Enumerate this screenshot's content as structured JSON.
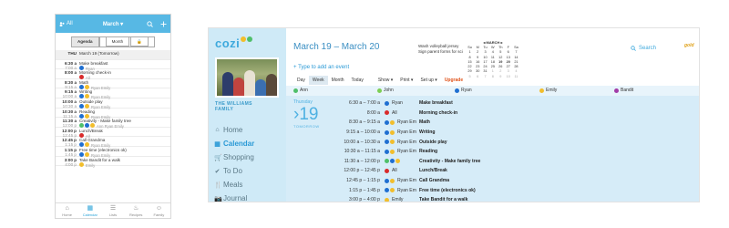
{
  "colors": {
    "ann": "#4fbf6a",
    "john": "#7ccf54",
    "ryan": "#1f6fd1",
    "emily": "#f2be2c",
    "bandit": "#a23ca8",
    "all": "#d92b2b",
    "brand": "#3ea9dd"
  },
  "mobile": {
    "top": {
      "all_label": "All",
      "month_label": "March"
    },
    "toggle": {
      "agenda": "Agenda",
      "month": "Month"
    },
    "date_header": {
      "day": "THU",
      "label": "March 19 (Tomorrow)"
    },
    "rows": [
      {
        "time": "6:30 a",
        "end": "7:00 a",
        "title": "Make breakfast",
        "who": "Ryan"
      },
      {
        "time": "8:00 a",
        "end": "",
        "title": "Morning check-in",
        "who": "All"
      },
      {
        "time": "8:30 a",
        "end": "9:15 a",
        "title": "Math",
        "who": "Ryan  Emily"
      },
      {
        "time": "9:15 a",
        "end": "10:00 a",
        "title": "Writing",
        "who": "Ryan  Emily"
      },
      {
        "time": "10:00 a",
        "end": "10:30 a",
        "title": "Outside play",
        "who": "Ryan  Emily"
      },
      {
        "time": "10:30 a",
        "end": "11:15 a",
        "title": "Reading",
        "who": "Ryan  Emily"
      },
      {
        "time": "11:30 a",
        "end": "12:00 p",
        "title": "Creativity - Make family tree",
        "who": "Ann  Ryan  Emily"
      },
      {
        "time": "12:00 p",
        "end": "12:45 p",
        "title": "Lunch/Break",
        "who": "All"
      },
      {
        "time": "12:45 p",
        "end": "1:15 p",
        "title": "Call Grandma",
        "who": "Ryan  Emily"
      },
      {
        "time": "1:15 p",
        "end": "1:45 p",
        "title": "Free time (electronics ok)",
        "who": "Ryan  Emily"
      },
      {
        "time": "3:00 p",
        "end": "4:00 p",
        "title": "Take Bandit for a walk",
        "who": "Emily"
      }
    ],
    "nav": [
      "Home",
      "Calendar",
      "Lists",
      "Recipes",
      "Family"
    ]
  },
  "desktop": {
    "logo": "cozi",
    "family_name_line1": "THE WILLIAMS",
    "family_name_line2": "FAMILY",
    "nav": [
      {
        "label": "Home",
        "icon": "house-icon"
      },
      {
        "label": "Calendar",
        "icon": "calendar-icon"
      },
      {
        "label": "Shopping",
        "icon": "cart-icon"
      },
      {
        "label": "To Do",
        "icon": "check-icon"
      },
      {
        "label": "Meals",
        "icon": "utensils-icon"
      },
      {
        "label": "Journal",
        "icon": "camera-icon"
      }
    ],
    "range": "March 19 – March 20",
    "notes": [
      "Wash volleyball jersey",
      "Sign parent forms for sci"
    ],
    "mini_cal": {
      "title": "MARCH",
      "headers": [
        "Su",
        "M",
        "Tu",
        "W",
        "Th",
        "F",
        "Sa"
      ],
      "weeks": [
        [
          "1",
          "2",
          "3",
          "4",
          "5",
          "6",
          "7"
        ],
        [
          "8",
          "9",
          "10",
          "11",
          "12",
          "13",
          "14"
        ],
        [
          "15",
          "16",
          "17",
          "18",
          "19",
          "20",
          "21"
        ],
        [
          "22",
          "23",
          "24",
          "25",
          "26",
          "27",
          "28"
        ],
        [
          "29",
          "30",
          "31",
          "1",
          "2",
          "3",
          "4"
        ],
        [
          "5",
          "6",
          "7",
          "8",
          "9",
          "10",
          "11"
        ]
      ]
    },
    "search_label": "Search",
    "gold_label": "gold",
    "type_add": "+ Type to add an event",
    "tabs": [
      "Day",
      "Week",
      "Month",
      "Today"
    ],
    "menus": [
      "Show ▾",
      "Print ▾",
      "Set up ▾"
    ],
    "upgrade": "Upgrade",
    "people": [
      "Ann",
      "John",
      "Ryan",
      "Emily",
      "Bandit"
    ],
    "day": {
      "name": "Thursday",
      "number": "19",
      "tomorrow": "TOMORROW"
    },
    "events": [
      {
        "time": "6:30 a – 7:00 a",
        "who": "Ryan",
        "title": "Make breakfast"
      },
      {
        "time": "8:00 a",
        "who": "All",
        "title": "Morning check-in"
      },
      {
        "time": "8:30 a – 9:15 a",
        "who": "Ryan  Em",
        "title": "Math"
      },
      {
        "time": "9:15 a – 10:00 a",
        "who": "Ryan  Em",
        "title": "Writing"
      },
      {
        "time": "10:00 a – 10:30 a",
        "who": "Ryan  Em",
        "title": "Outside play"
      },
      {
        "time": "10:30 a – 11:15 a",
        "who": "Ryan  Em",
        "title": "Reading"
      },
      {
        "time": "11:30 a – 12:00 p",
        "who": "",
        "title": "Creativity - Make family tree"
      },
      {
        "time": "12:00 p – 12:45 p",
        "who": "All",
        "title": "Lunch/Break"
      },
      {
        "time": "12:45 p – 1:15 p",
        "who": "Ryan  Em",
        "title": "Call Grandma"
      },
      {
        "time": "1:15 p – 1:45 p",
        "who": "Ryan  Em",
        "title": "Free time (electronics ok)"
      },
      {
        "time": "3:00 p – 4:00 p",
        "who": "Emily",
        "title": "Take Bandit for a walk"
      }
    ]
  }
}
